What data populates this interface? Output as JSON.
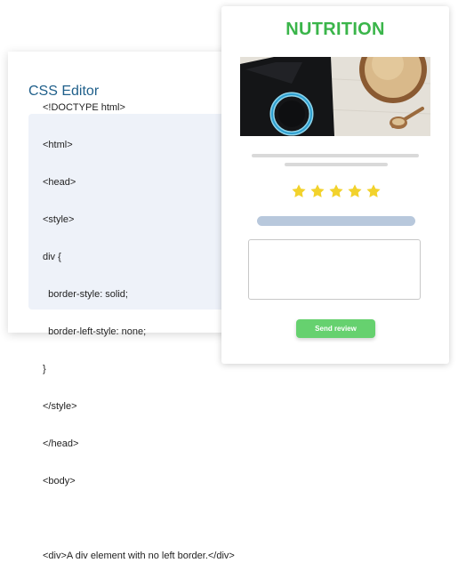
{
  "editor": {
    "title": "CSS Editor",
    "code_lines": [
      "<!DOCTYPE html>",
      "<html>",
      "<head>",
      "<style>",
      "div {",
      "  border-style: solid;",
      "  border-left-style: none;",
      "}",
      "</style>",
      "</head>",
      "<body>",
      "",
      "<div>A div element with no left border.</div>"
    ]
  },
  "review": {
    "title": "NUTRITION",
    "rating": 5,
    "max_rating": 5,
    "star_color": "#f2d22c",
    "title_color": "#3ab54a",
    "review_text": "",
    "send_label": "Send review"
  }
}
